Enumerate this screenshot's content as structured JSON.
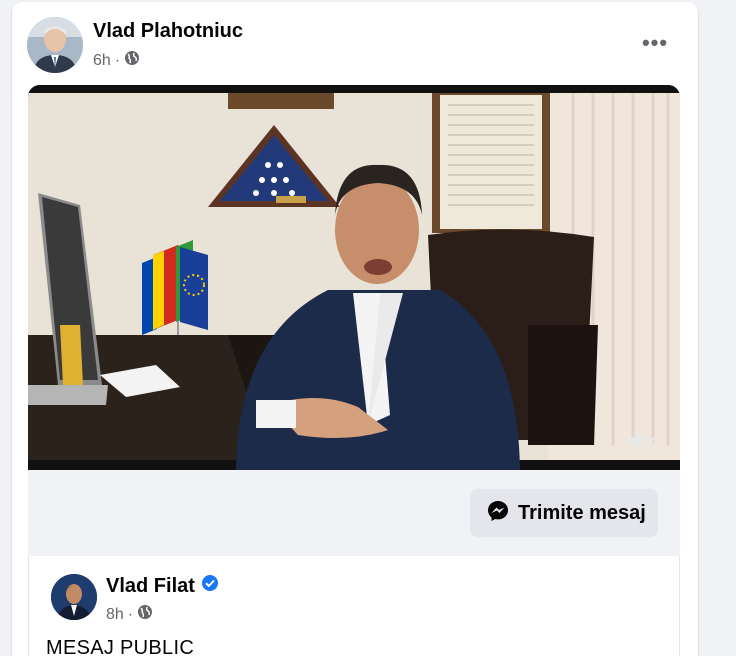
{
  "post": {
    "author": "Vlad Plahotniuc",
    "time": "6h",
    "separator": "·",
    "audience_icon": "globe-icon",
    "more_icon": "more-horizontal-icon"
  },
  "video": {
    "mute_icon": "speaker-muted-icon"
  },
  "cta": {
    "icon": "messenger-icon",
    "label": "Trimite mesaj"
  },
  "shared_post": {
    "author": "Vlad Filat",
    "verified_icon": "verified-badge-icon",
    "time": "8h",
    "separator": "·",
    "audience_icon": "globe-icon",
    "text": "MESAJ PUBLIC"
  },
  "colors": {
    "background": "#f0f2f5",
    "card": "#ffffff",
    "secondary_text": "#65676b",
    "verified": "#1877f2",
    "button_bg": "#e4e6eb"
  }
}
